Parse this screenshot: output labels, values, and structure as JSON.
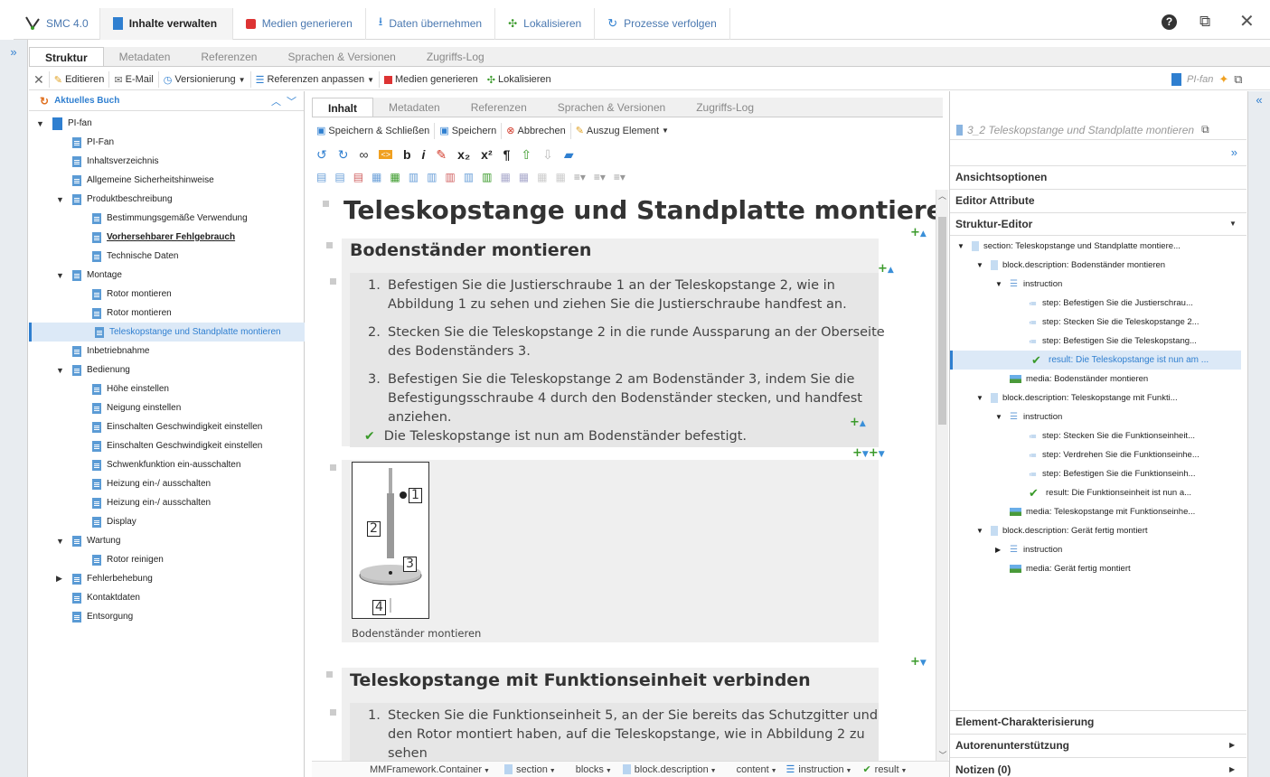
{
  "app": {
    "name": "SMC 4.0"
  },
  "main_tabs": [
    {
      "label": "Inhalte verwalten"
    },
    {
      "label": "Medien generieren"
    },
    {
      "label": "Daten übernehmen"
    },
    {
      "label": "Lokalisieren"
    },
    {
      "label": "Prozesse verfolgen"
    }
  ],
  "left_tabs": [
    "Struktur",
    "Metadaten",
    "Referenzen",
    "Sprachen & Versionen",
    "Zugriffs-Log"
  ],
  "toolbar": {
    "edit": "Editieren",
    "email": "E-Mail",
    "versioning": "Versionierung",
    "refs": "Referenzen anpassen",
    "media": "Medien generieren",
    "localize": "Lokalisieren",
    "current_doc": "PI-fan"
  },
  "left_panel": {
    "title": "Aktuelles Buch"
  },
  "tree": [
    {
      "label": "PI-fan",
      "level": 0,
      "kind": "book",
      "caret": "open"
    },
    {
      "label": "PI-Fan",
      "level": 1,
      "kind": "doc"
    },
    {
      "label": "Inhaltsverzeichnis",
      "level": 1,
      "kind": "doc"
    },
    {
      "label": "Allgemeine Sicherheitshinweise",
      "level": 1,
      "kind": "doc"
    },
    {
      "label": "Produktbeschreibung",
      "level": 1,
      "kind": "doc",
      "caret": "open"
    },
    {
      "label": "Bestimmungsgemäße Verwendung",
      "level": 2,
      "kind": "doc"
    },
    {
      "label": "Vorhersehbarer Fehlgebrauch",
      "level": 2,
      "kind": "doc",
      "style": "bold"
    },
    {
      "label": "Technische Daten",
      "level": 2,
      "kind": "doc"
    },
    {
      "label": "Montage",
      "level": 1,
      "kind": "doc",
      "caret": "open"
    },
    {
      "label": "Rotor montieren",
      "level": 2,
      "kind": "doc"
    },
    {
      "label": "Rotor montieren",
      "level": 2,
      "kind": "doc"
    },
    {
      "label": "Teleskopstange und Standplatte montieren",
      "level": 2,
      "kind": "doc",
      "selected": true
    },
    {
      "label": "Inbetriebnahme",
      "level": 1,
      "kind": "doc"
    },
    {
      "label": "Bedienung",
      "level": 1,
      "kind": "doc",
      "caret": "open"
    },
    {
      "label": "Höhe einstellen",
      "level": 2,
      "kind": "doc"
    },
    {
      "label": "Neigung einstellen",
      "level": 2,
      "kind": "doc"
    },
    {
      "label": "Einschalten Geschwindigkeit einstellen",
      "level": 2,
      "kind": "doc"
    },
    {
      "label": "Einschalten Geschwindigkeit einstellen",
      "level": 2,
      "kind": "doc"
    },
    {
      "label": "Schwenkfunktion ein-ausschalten",
      "level": 2,
      "kind": "doc"
    },
    {
      "label": "Heizung ein-/ ausschalten",
      "level": 2,
      "kind": "doc"
    },
    {
      "label": "Heizung ein-/ ausschalten",
      "level": 2,
      "kind": "doc"
    },
    {
      "label": "Display",
      "level": 2,
      "kind": "doc"
    },
    {
      "label": "Wartung",
      "level": 1,
      "kind": "doc",
      "caret": "open"
    },
    {
      "label": "Rotor reinigen",
      "level": 2,
      "kind": "doc"
    },
    {
      "label": "Fehlerbehebung",
      "level": 1,
      "kind": "doc",
      "caret": "closed"
    },
    {
      "label": "Kontaktdaten",
      "level": 1,
      "kind": "doc"
    },
    {
      "label": "Entsorgung",
      "level": 1,
      "kind": "doc"
    }
  ],
  "editor_tabs": [
    "Inhalt",
    "Metadaten",
    "Referenzen",
    "Sprachen & Versionen",
    "Zugriffs-Log"
  ],
  "editor_toolbar": {
    "save_close": "Speichern & Schließen",
    "save": "Speichern",
    "cancel": "Abbrechen",
    "excerpt": "Auszug Element"
  },
  "content": {
    "title": "Teleskopstange und Standplatte montieren",
    "h1": "Bodenständer montieren",
    "steps1": [
      {
        "num": "1.",
        "line1": "Befestigen Sie die Justierschraube 1 an der Teleskopstange 2, wie in",
        "line2": "Abbildung 1 zu sehen und ziehen Sie die Justierschraube handfest an.",
        "line3": ""
      },
      {
        "num": "2.",
        "line1": "Stecken Sie die Teleskopstange 2 in die runde Aussparung an der Oberseite",
        "line2": "des Bodenständers 3.",
        "line3": ""
      },
      {
        "num": "3.",
        "line1": "Befestigen Sie die Teleskopstange 2 am Bodenständer 3, indem Sie die",
        "line2": "Befestigungsschraube 4 durch den Bodenständer stecken, und handfest",
        "line3": "anziehen."
      }
    ],
    "result": "Die Teleskopstange ist nun am Bodenständer befestigt.",
    "figure_labels": [
      "1",
      "2",
      "3",
      "4"
    ],
    "caption": "Bodenständer montieren",
    "h2": "Teleskopstange mit Funktionseinheit verbinden",
    "steps2": [
      {
        "num": "1.",
        "line1": "Stecken Sie die Funktionseinheit 5, an der Sie bereits das Schutzgitter und",
        "line2": "den Rotor montiert haben, auf die Teleskopstange, wie in Abbildung 2 zu",
        "line3": "sehen"
      }
    ]
  },
  "breadcrumb": [
    "MMFramework.Container",
    "section",
    "blocks",
    "block.description",
    "content",
    "instruction",
    "result"
  ],
  "right_panel": {
    "title": "3_2 Teleskopstange und Standplatte montieren",
    "sections": {
      "view": "Ansichtsoptionen",
      "attrs": "Editor Attribute",
      "struct": "Struktur-Editor",
      "char": "Element-Charakterisierung",
      "author": "Autorenunterstützung",
      "notes": "Notizen (0)"
    },
    "structure": [
      {
        "label": "section: Teleskopstange und Standplatte montiere...",
        "level": 0,
        "icon": "doc",
        "caret": "open"
      },
      {
        "label": "block.description: Bodenständer montieren",
        "level": 1,
        "icon": "doc",
        "caret": "open"
      },
      {
        "label": "instruction",
        "level": 2,
        "icon": "list",
        "caret": "open"
      },
      {
        "label": "step: Befestigen Sie die Justierschrau...",
        "level": 3,
        "icon": "step"
      },
      {
        "label": "step: Stecken Sie die Teleskopstange 2...",
        "level": 3,
        "icon": "step"
      },
      {
        "label": "step: Befestigen Sie die Teleskopstang...",
        "level": 3,
        "icon": "step"
      },
      {
        "label": "result: Die Teleskopstange ist nun am ...",
        "level": 3,
        "icon": "check",
        "selected": true
      },
      {
        "label": "media: Bodenständer montieren",
        "level": 2,
        "icon": "media"
      },
      {
        "label": "block.description: Teleskopstange mit Funkti...",
        "level": 1,
        "icon": "doc",
        "caret": "open"
      },
      {
        "label": "instruction",
        "level": 2,
        "icon": "list",
        "caret": "open"
      },
      {
        "label": "step: Stecken Sie die Funktionseinheit...",
        "level": 3,
        "icon": "step"
      },
      {
        "label": "step: Verdrehen Sie die Funktionseinhe...",
        "level": 3,
        "icon": "step"
      },
      {
        "label": "step: Befestigen Sie die Funktionseinh...",
        "level": 3,
        "icon": "step"
      },
      {
        "label": "result: Die Funktionseinheit ist nun a...",
        "level": 3,
        "icon": "check"
      },
      {
        "label": "media: Teleskopstange mit Funktionseinhe...",
        "level": 2,
        "icon": "media"
      },
      {
        "label": "block.description: Gerät fertig montiert",
        "level": 1,
        "icon": "doc",
        "caret": "open"
      },
      {
        "label": "instruction",
        "level": 2,
        "icon": "list",
        "caret": "closed"
      },
      {
        "label": "media: Gerät fertig montiert",
        "level": 2,
        "icon": "media"
      }
    ]
  },
  "colors": {
    "accent": "#2f7fd0",
    "selected_bg": "#dce9f7",
    "green": "#3a9a2a",
    "red": "#d23a2a",
    "gray_block": "#efefef"
  }
}
